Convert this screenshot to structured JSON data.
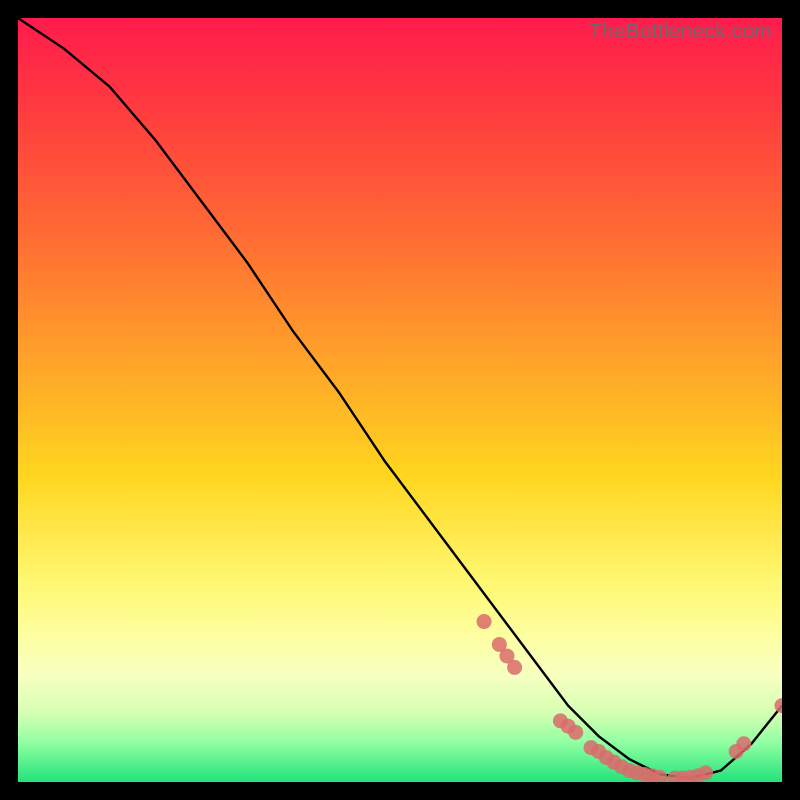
{
  "watermark": "TheBottleneck.com",
  "chart_data": {
    "type": "line",
    "title": "",
    "xlabel": "",
    "ylabel": "",
    "xlim": [
      0,
      100
    ],
    "ylim": [
      0,
      100
    ],
    "grid": false,
    "series": [
      {
        "name": "curve",
        "style": "solid",
        "color": "#000000",
        "x": [
          0,
          6,
          12,
          18,
          24,
          30,
          36,
          42,
          48,
          54,
          60,
          66,
          72,
          76,
          80,
          84,
          88,
          92,
          96,
          100
        ],
        "y": [
          100,
          96,
          91,
          84,
          76,
          68,
          59,
          51,
          42,
          34,
          26,
          18,
          10,
          6,
          3,
          1,
          0.5,
          1.5,
          5,
          10
        ]
      }
    ],
    "marker_color": "#d96b6b",
    "markers": [
      {
        "x": 61,
        "y": 21
      },
      {
        "x": 63,
        "y": 18
      },
      {
        "x": 64,
        "y": 16.5
      },
      {
        "x": 65,
        "y": 15
      },
      {
        "x": 71,
        "y": 8
      },
      {
        "x": 72,
        "y": 7.3
      },
      {
        "x": 73,
        "y": 6.5
      },
      {
        "x": 75,
        "y": 4.5
      },
      {
        "x": 76,
        "y": 4
      },
      {
        "x": 77,
        "y": 3.2
      },
      {
        "x": 78,
        "y": 2.6
      },
      {
        "x": 79,
        "y": 2
      },
      {
        "x": 80,
        "y": 1.5
      },
      {
        "x": 81,
        "y": 1.2
      },
      {
        "x": 82,
        "y": 1
      },
      {
        "x": 83,
        "y": 0.8
      },
      {
        "x": 84,
        "y": 0.6
      },
      {
        "x": 86,
        "y": 0.5
      },
      {
        "x": 87,
        "y": 0.5
      },
      {
        "x": 88,
        "y": 0.6
      },
      {
        "x": 89,
        "y": 0.8
      },
      {
        "x": 90,
        "y": 1.2
      },
      {
        "x": 94,
        "y": 4
      },
      {
        "x": 95,
        "y": 5
      },
      {
        "x": 100,
        "y": 10
      }
    ]
  }
}
